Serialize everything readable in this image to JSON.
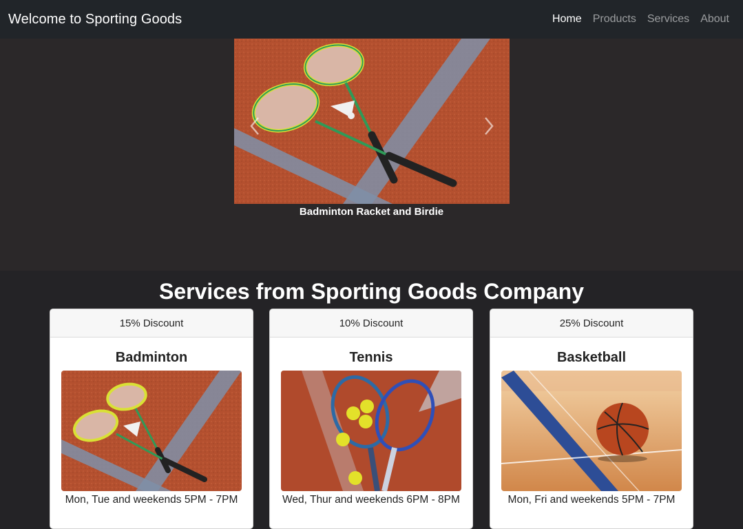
{
  "navbar": {
    "brand": "Welcome to Sporting Goods",
    "links": [
      "Home",
      "Products",
      "Services",
      "About"
    ]
  },
  "carousel": {
    "caption": "Badminton Racket and Birdie"
  },
  "services": {
    "title": "Services from Sporting Goods Company",
    "cards": [
      {
        "header": "15% Discount",
        "title": "Badminton",
        "text": "Mon, Tue and weekends 5PM - 7PM"
      },
      {
        "header": "10% Discount",
        "title": "Tennis",
        "text": "Wed, Thur and weekends 6PM - 8PM"
      },
      {
        "header": "25% Discount",
        "title": "Basketball",
        "text": "Mon, Fri and weekends 5PM - 7PM"
      }
    ]
  }
}
